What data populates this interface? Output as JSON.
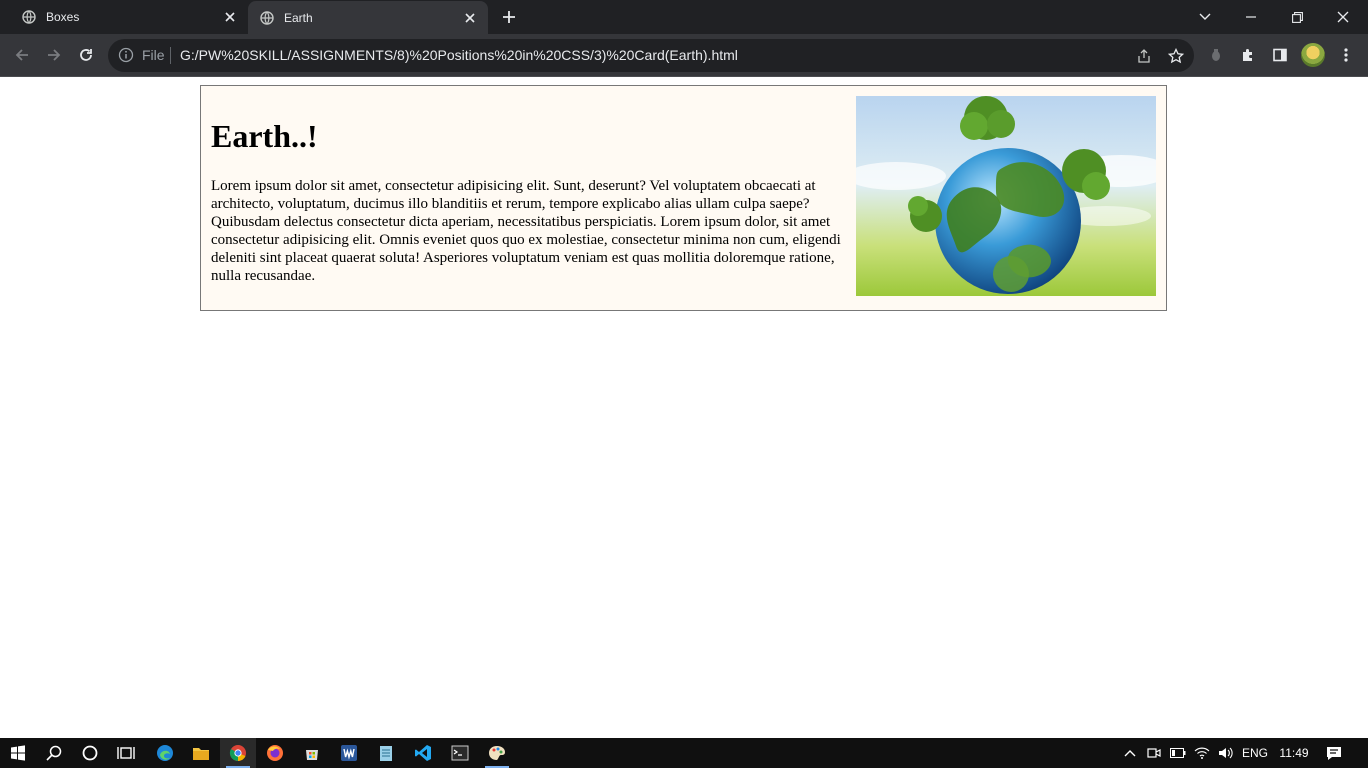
{
  "browser": {
    "tabs": [
      {
        "title": "Boxes",
        "active": false
      },
      {
        "title": "Earth",
        "active": true
      }
    ],
    "address": {
      "scheme_label": "File",
      "url": "G:/PW%20SKILL/ASSIGNMENTS/8)%20Positions%20in%20CSS/3)%20Card(Earth).html"
    }
  },
  "page": {
    "card": {
      "title": "Earth..!",
      "body": "Lorem ipsum dolor sit amet, consectetur adipisicing elit. Sunt, deserunt? Vel voluptatem obcaecati at architecto, voluptatum, ducimus illo blanditiis et rerum, tempore explicabo alias ullam culpa saepe? Quibusdam delectus consectetur dicta aperiam, necessitatibus perspiciatis. Lorem ipsum dolor, sit amet consectetur adipisicing elit. Omnis eveniet quos quo ex molestiae, consectetur minima non cum, eligendi deleniti sint placeat quaerat soluta! Asperiores voluptatum veniam est quas mollitia doloremque ratione, nulla recusandae.",
      "background": "#fffaf3",
      "border_color": "#777777"
    }
  },
  "taskbar": {
    "language": "ENG",
    "time": "11:49"
  },
  "colors": {
    "tabstrip": "#202124",
    "toolbar": "#35363a",
    "omnibox": "#202124",
    "taskbar": "#101010"
  }
}
